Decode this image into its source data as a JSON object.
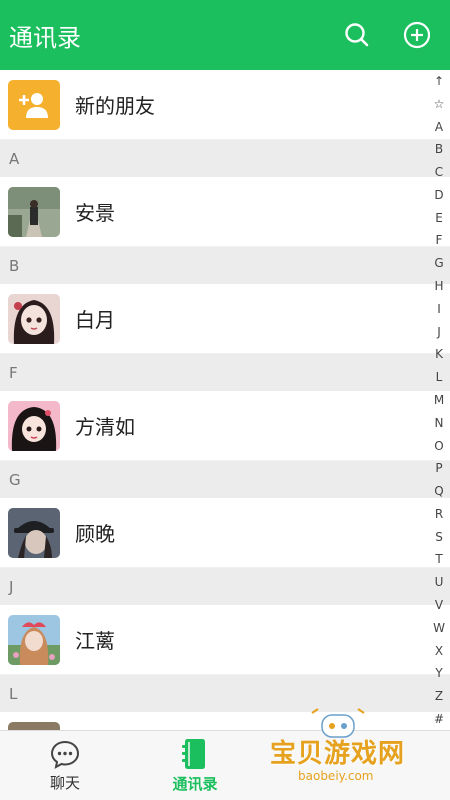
{
  "header": {
    "title": "通讯录"
  },
  "friends_entry": {
    "label": "新的朋友"
  },
  "contacts": [
    {
      "section": "A",
      "name": "安景"
    },
    {
      "section": "B",
      "name": "白月"
    },
    {
      "section": "F",
      "name": "方清如"
    },
    {
      "section": "G",
      "name": "顾晚"
    },
    {
      "section": "J",
      "name": "江蓠"
    },
    {
      "section": "L",
      "name": ""
    }
  ],
  "index_bar": [
    "↑",
    "☆",
    "A",
    "B",
    "C",
    "D",
    "E",
    "F",
    "G",
    "H",
    "I",
    "J",
    "K",
    "L",
    "M",
    "N",
    "O",
    "P",
    "Q",
    "R",
    "S",
    "T",
    "U",
    "V",
    "W",
    "X",
    "Y",
    "Z",
    "#"
  ],
  "tabs": [
    {
      "label": "聊天",
      "active": false
    },
    {
      "label": "通讯录",
      "active": true
    }
  ],
  "watermark": {
    "text": "宝贝游戏网",
    "domain": "baobeiy.com"
  },
  "colors": {
    "brand": "#1cbf5e",
    "friends_icon_bg": "#f5b02e"
  }
}
